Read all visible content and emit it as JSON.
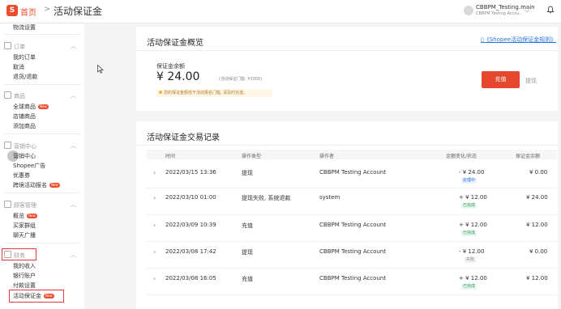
{
  "header": {
    "logo_letter": "S",
    "home": "首页",
    "separator": ">",
    "current": "活动保证金",
    "account_name": "CBBPM_Testing.main",
    "account_sub": "CBBPM Testing Accou.."
  },
  "sidebar": {
    "sections": [
      {
        "id": "logistics",
        "items": [
          "物流设置"
        ]
      },
      {
        "id": "orders",
        "title": "订单",
        "items": [
          "我的订单",
          "取消",
          "退货/退款"
        ]
      },
      {
        "id": "products",
        "title": "商品",
        "items": [
          "全球商品",
          "店铺商品",
          "添加商品"
        ],
        "new_item_index": 0
      },
      {
        "id": "marketing",
        "title": "营销中心",
        "items": [
          "营销中心",
          "Shopee广告",
          "优惠券",
          "跨境活动报名"
        ],
        "new_item_index": 3
      },
      {
        "id": "customer",
        "title": "顾客管理",
        "items": [
          "概览",
          "买家群组",
          "聊天广播"
        ],
        "new_item_index": 0
      },
      {
        "id": "finance",
        "title": "财务",
        "items": [
          "我的收入",
          "银行账户",
          "付款设置",
          "活动保证金"
        ],
        "new_item_index": 3
      }
    ],
    "new_badge": "New"
  },
  "overview": {
    "title": "活动保证金概览",
    "rules_link": "《Shopee活动保证金规则》",
    "balance_label": "保证金余额",
    "balance_amount": "¥ 24.00",
    "balance_note": "(活动保证门槛: ¥3000)",
    "warning": "您的保证金额低于活动报名门槛, 请及时充值。",
    "recharge_button": "充值",
    "withdraw_button": "提现"
  },
  "records": {
    "title": "活动保证金交易记录",
    "columns": [
      "时间",
      "操作类型",
      "操作者",
      "金额变化/状态",
      "保证金余额"
    ],
    "rows": [
      {
        "time": "2022/03/15 13:36",
        "type": "提现",
        "operator": "CBBPM Testing Account",
        "change": "- ¥ 24.00",
        "status": "处理中",
        "status_kind": "blue",
        "balance": "¥ 0.00"
      },
      {
        "time": "2022/03/10 01:00",
        "type": "提现失败, 系统退款",
        "operator": "system",
        "change": "+ ¥ 12.00",
        "status": "已完成",
        "status_kind": "green",
        "balance": "¥ 24.00"
      },
      {
        "time": "2022/03/09 10:39",
        "type": "充值",
        "operator": "CBBPM Testing Account",
        "change": "+ ¥ 12.00",
        "status": "已完成",
        "status_kind": "green",
        "balance": "¥ 12.00"
      },
      {
        "time": "2022/03/08 17:42",
        "type": "提现",
        "operator": "CBBPM Testing Account",
        "change": "- ¥ 12.00",
        "status": "失败",
        "status_kind": "gray",
        "balance": "¥ 0.00"
      },
      {
        "time": "2022/03/08 16:05",
        "type": "充值",
        "operator": "CBBPM Testing Account",
        "change": "+ ¥ 12.00",
        "status": "已完成",
        "status_kind": "green",
        "balance": "¥ 12.00"
      }
    ]
  },
  "colors": {
    "brand": "#ee4d2d",
    "link": "#2673dd",
    "highlight_box": "#e03a3a"
  }
}
